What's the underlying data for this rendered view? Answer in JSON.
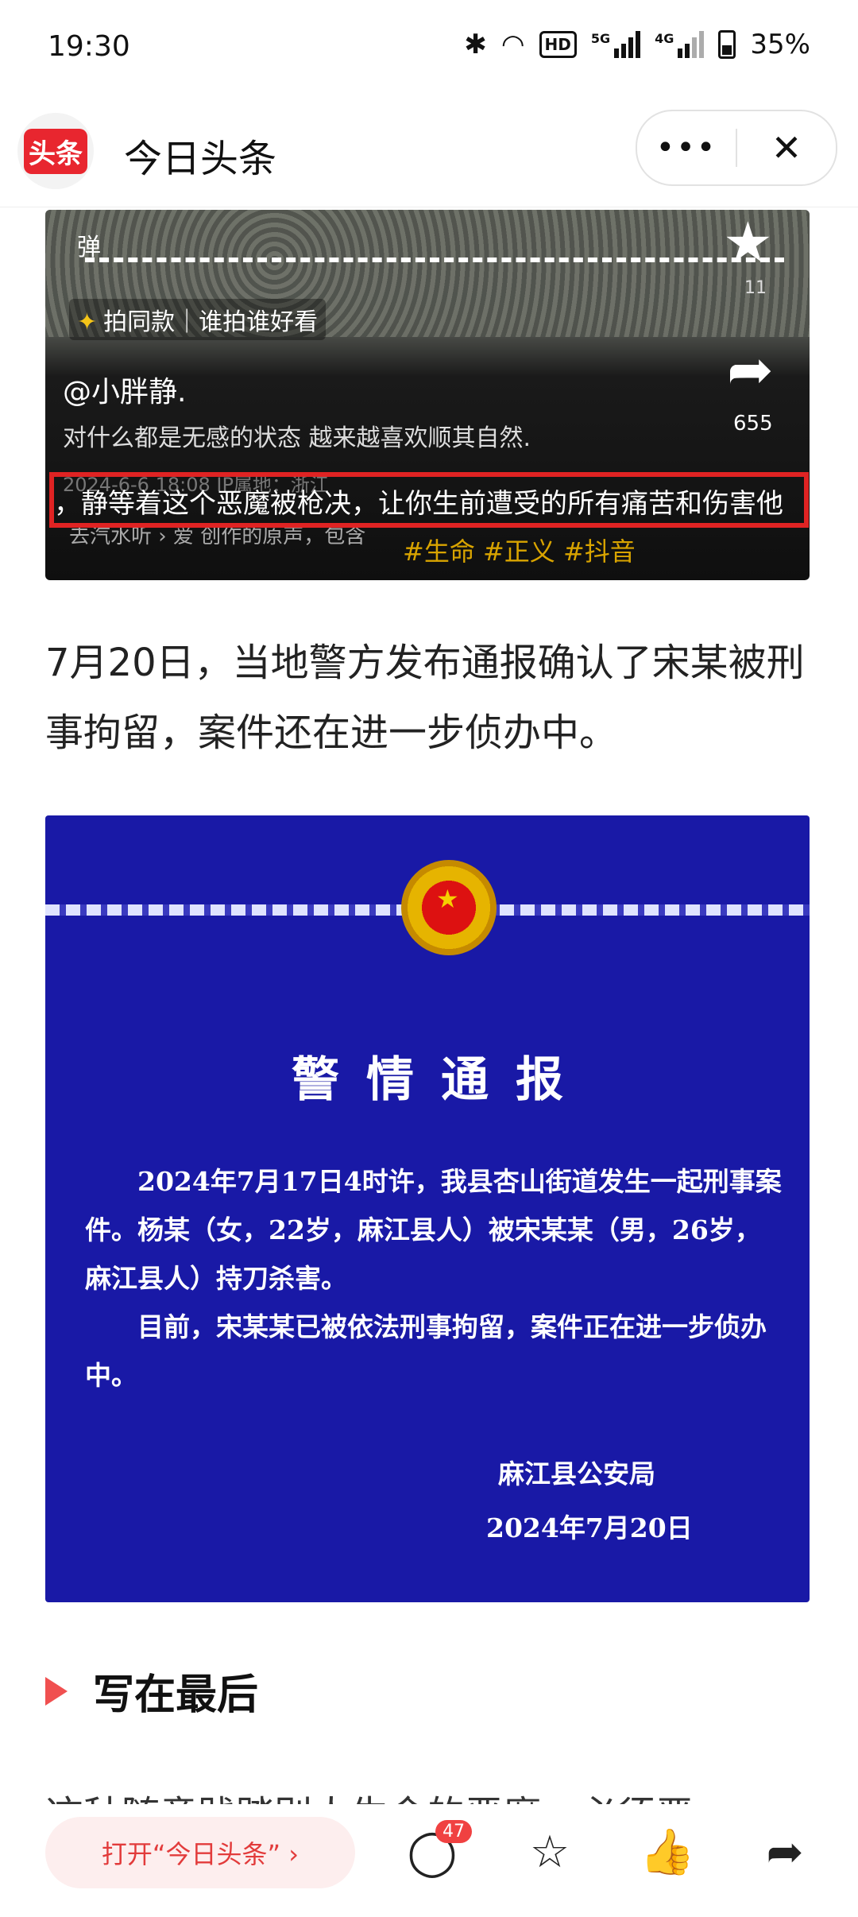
{
  "status_bar": {
    "time": "19:30",
    "battery": "35%",
    "hd": "HD",
    "net1": "5G",
    "net2": "4G"
  },
  "header": {
    "logo_text": "头条",
    "title": "今日头条",
    "more": "•••",
    "close": "✕"
  },
  "video": {
    "danmu": "弹",
    "same_style": "拍同款｜谁拍谁好看",
    "username": "@小胖静.",
    "description": "对什么都是无感的状态 越来越喜欢顺其自然.",
    "star_count": "11",
    "share_count": "655",
    "meta": "2024-6-6 18:08 IP属地：浙江",
    "subtitle": "，静等着这个恶魔被枪决，让你生前遭受的所有痛苦和伤害他",
    "music": "去汽水听 › 爱 创作的原声，包含",
    "tags": "#生命 #正义 #抖音"
  },
  "article": {
    "paragraph": "7月20日，当地警方发布通报确认了宋某被刑事拘留，案件还在进一步侦办中。",
    "section_heading": "写在最后",
    "partial_text": "这种随意践踏别人生命的恶魔，必须严"
  },
  "notice": {
    "title": "警情通报",
    "body": [
      "2024年7月17日4时许，我县杏山街道发生一起刑事案件。杨某（女，22岁，麻江县人）被宋某某（男，26岁，麻江县人）持刀杀害。",
      "目前，宋某某已被依法刑事拘留，案件正在进一步侦办中。"
    ],
    "signature": "麻江县公安局",
    "date": "2024年7月20日"
  },
  "bottom_bar": {
    "open_button": "打开“今日头条” ›",
    "comment_count": "47",
    "icons": [
      "comment-icon",
      "star-icon",
      "like-icon",
      "share-icon"
    ]
  },
  "colors": {
    "accent": "#e8262f",
    "notice_bg": "#1919a6",
    "highlight_box": "#e02323"
  }
}
